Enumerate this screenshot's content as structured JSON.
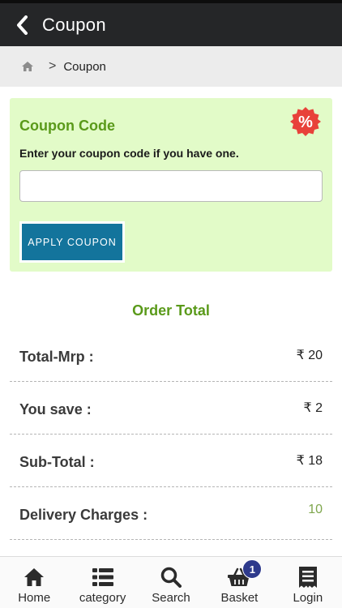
{
  "header": {
    "title": "Coupon"
  },
  "breadcrumb": {
    "current": "Coupon",
    "separator": ">"
  },
  "coupon": {
    "title": "Coupon Code",
    "subtitle": "Enter your coupon code if you have one.",
    "input_value": "",
    "input_placeholder": "",
    "apply_label": "APPLY COUPON",
    "badge_symbol": "%"
  },
  "order_total": {
    "title": "Order Total",
    "rows": [
      {
        "label": "Total-Mrp :",
        "value": "₹ 20"
      },
      {
        "label": "You save :",
        "value": "₹ 2"
      },
      {
        "label": "Sub-Total :",
        "value": "₹ 18"
      },
      {
        "label": "Delivery Charges :",
        "value": "10"
      }
    ]
  },
  "bottom_nav": {
    "items": [
      {
        "label": "Home",
        "icon": "home-icon"
      },
      {
        "label": "category",
        "icon": "list-icon"
      },
      {
        "label": "Search",
        "icon": "search-icon"
      },
      {
        "label": "Basket",
        "icon": "basket-icon",
        "badge": "1"
      },
      {
        "label": "Login",
        "icon": "receipt-icon"
      }
    ]
  },
  "colors": {
    "header_bg": "#252628",
    "accent_green": "#5a9a1a",
    "coupon_bg": "#e2fbc8",
    "button_blue": "#13749c",
    "badge_red": "#e8413a",
    "basket_badge": "#2e3a8c"
  }
}
